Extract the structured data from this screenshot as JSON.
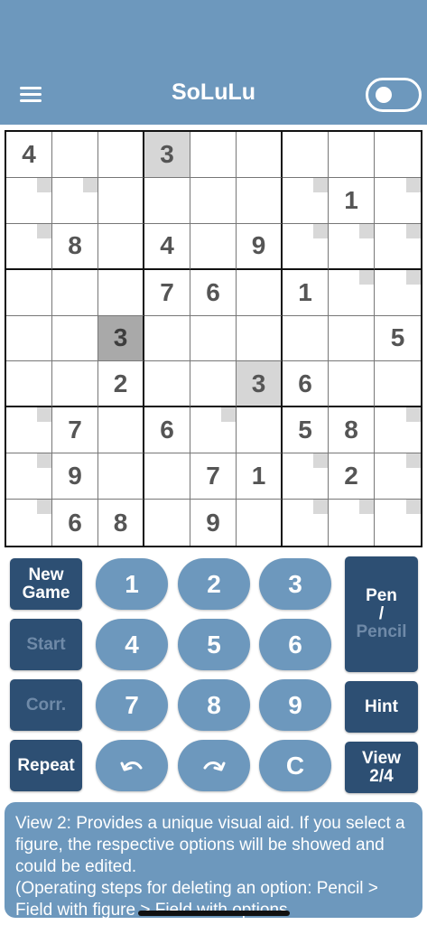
{
  "header": {
    "title": "SoLuLu",
    "menu_icon": "hamburger-menu-icon",
    "toggle_state": "off"
  },
  "board": {
    "rows": [
      [
        "4",
        "",
        "",
        "3",
        "",
        "",
        "",
        "",
        ""
      ],
      [
        "",
        "",
        "",
        "",
        "",
        "",
        "",
        "1",
        ""
      ],
      [
        "",
        "8",
        "",
        "4",
        "",
        "9",
        "",
        "",
        ""
      ],
      [
        "",
        "",
        "",
        "7",
        "6",
        "",
        "1",
        "",
        ""
      ],
      [
        "",
        "",
        "3",
        "",
        "",
        "",
        "",
        "",
        "5"
      ],
      [
        "",
        "",
        "2",
        "",
        "",
        "3",
        "6",
        "",
        ""
      ],
      [
        "",
        "7",
        "",
        "6",
        "",
        "",
        "5",
        "8",
        ""
      ],
      [
        "",
        "9",
        "",
        "",
        "7",
        "1",
        "",
        "2",
        ""
      ],
      [
        "",
        "6",
        "8",
        "",
        "9",
        "",
        "",
        "",
        ""
      ]
    ],
    "highlight_light": [
      [
        0,
        3
      ],
      [
        5,
        5
      ]
    ],
    "highlight_dark": [
      [
        4,
        2
      ]
    ],
    "corner_marks": [
      [
        1,
        0
      ],
      [
        1,
        1
      ],
      [
        1,
        6
      ],
      [
        1,
        8
      ],
      [
        2,
        0
      ],
      [
        2,
        6
      ],
      [
        2,
        7
      ],
      [
        2,
        8
      ],
      [
        3,
        7
      ],
      [
        3,
        8
      ],
      [
        6,
        0
      ],
      [
        6,
        4
      ],
      [
        6,
        8
      ],
      [
        7,
        0
      ],
      [
        7,
        6
      ],
      [
        7,
        8
      ],
      [
        8,
        0
      ],
      [
        8,
        6
      ],
      [
        8,
        7
      ],
      [
        8,
        8
      ]
    ],
    "colors": {
      "given": "#555555",
      "highlight_light": "#d6d6d6",
      "highlight_dark": "#a9a9a9",
      "mark": "#d8d8d8"
    }
  },
  "controls": {
    "new_game": "New\nGame",
    "start": "Start",
    "corr": "Corr.",
    "repeat": "Repeat",
    "pen": "Pen",
    "slash": "/",
    "pencil": "Pencil",
    "hint": "Hint",
    "view": "View\n2/4",
    "numbers": [
      "1",
      "2",
      "3",
      "4",
      "5",
      "6",
      "7",
      "8",
      "9"
    ],
    "undo_icon": "undo-arrow-icon",
    "redo_icon": "redo-arrow-icon",
    "clear": "C"
  },
  "help": {
    "text": "View 2: Provides a unique visual aid. If you select a figure, the respective options will be showed and could be edited.\n(Operating steps for deleting an option: Pencil > Field with figure > Field with options"
  },
  "colors": {
    "primary": "#6d98bd",
    "dark": "#2d4f73",
    "disabled_text": "#6f8aa8"
  }
}
